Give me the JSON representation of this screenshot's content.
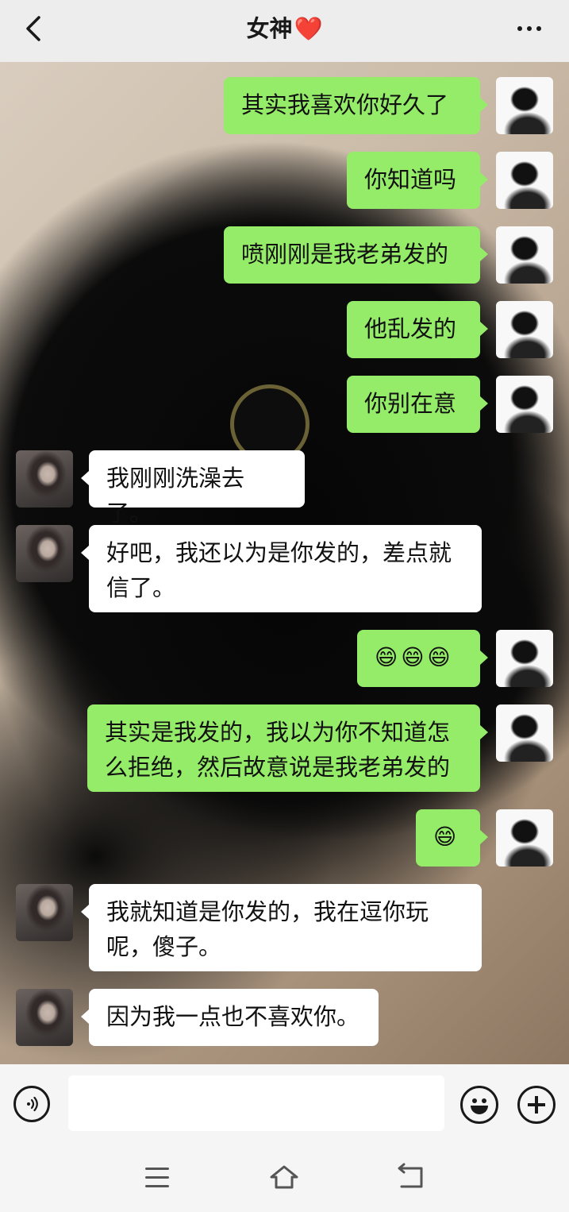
{
  "header": {
    "title": "女神",
    "title_heart": "❤️"
  },
  "messages": [
    {
      "side": "me",
      "text": "其实我喜欢你好久了"
    },
    {
      "side": "me",
      "text": "你知道吗"
    },
    {
      "side": "me",
      "text": "喷刚刚是我老弟发的"
    },
    {
      "side": "me",
      "text": "他乱发的"
    },
    {
      "side": "me",
      "text": "你别在意"
    },
    {
      "side": "her",
      "text": "我刚刚洗澡去了。"
    },
    {
      "side": "her",
      "text": "好吧，我还以为是你发的，差点就信了。"
    },
    {
      "side": "me",
      "text": "😄😄😄"
    },
    {
      "side": "me",
      "text": "其实是我发的，我以为你不知道怎么拒绝，然后故意说是我老弟发的"
    },
    {
      "side": "me",
      "text": "😄"
    },
    {
      "side": "her",
      "text": "我就知道是你发的，我在逗你玩呢，傻子。"
    },
    {
      "side": "her",
      "text": "因为我一点也不喜欢你。"
    }
  ],
  "input": {
    "value": "",
    "placeholder": ""
  },
  "colors": {
    "my_bubble": "#95ec69",
    "her_bubble": "#ffffff",
    "header_bg": "#ededed",
    "heart": "#e8212f"
  },
  "icons": [
    "back-arrow-icon",
    "more-dots-icon",
    "voice-icon",
    "emoji-icon",
    "plus-icon",
    "menu-icon",
    "home-icon",
    "back-nav-icon"
  ]
}
